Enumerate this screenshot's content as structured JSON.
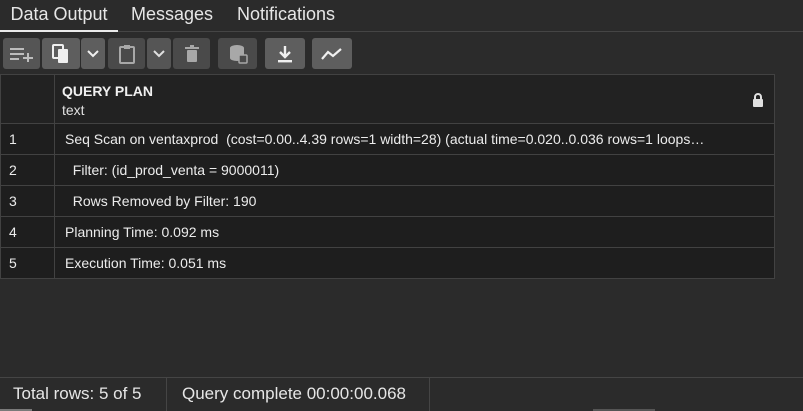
{
  "tabs": [
    {
      "label": "Data Output",
      "active": true
    },
    {
      "label": "Messages",
      "active": false
    },
    {
      "label": "Notifications",
      "active": false
    }
  ],
  "toolbar": {
    "icons": [
      "add-row-icon",
      "copy-icon",
      "chevron-down-icon",
      "paste-icon",
      "chevron-down-icon",
      "delete-icon",
      "save-data-icon",
      "download-icon",
      "graph-visualiser-icon"
    ]
  },
  "grid": {
    "column": {
      "name": "QUERY PLAN",
      "type": "text",
      "icon": "lock-icon"
    },
    "rows": [
      {
        "num": "1",
        "value": "Seq Scan on ventaxprod  (cost=0.00..4.39 rows=1 width=28) (actual time=0.020..0.036 rows=1 loops…"
      },
      {
        "num": "2",
        "value": "  Filter: (id_prod_venta = 9000011)"
      },
      {
        "num": "3",
        "value": "  Rows Removed by Filter: 190"
      },
      {
        "num": "4",
        "value": "Planning Time: 0.092 ms"
      },
      {
        "num": "5",
        "value": "Execution Time: 0.051 ms"
      }
    ]
  },
  "status": {
    "total_rows": "Total rows: 5 of 5",
    "query_status": "Query complete 00:00:00.068"
  },
  "colors": {
    "background": "#2b2b2b",
    "grid_row": "#1e1e1e",
    "header": "#222222",
    "button": "#555555"
  }
}
